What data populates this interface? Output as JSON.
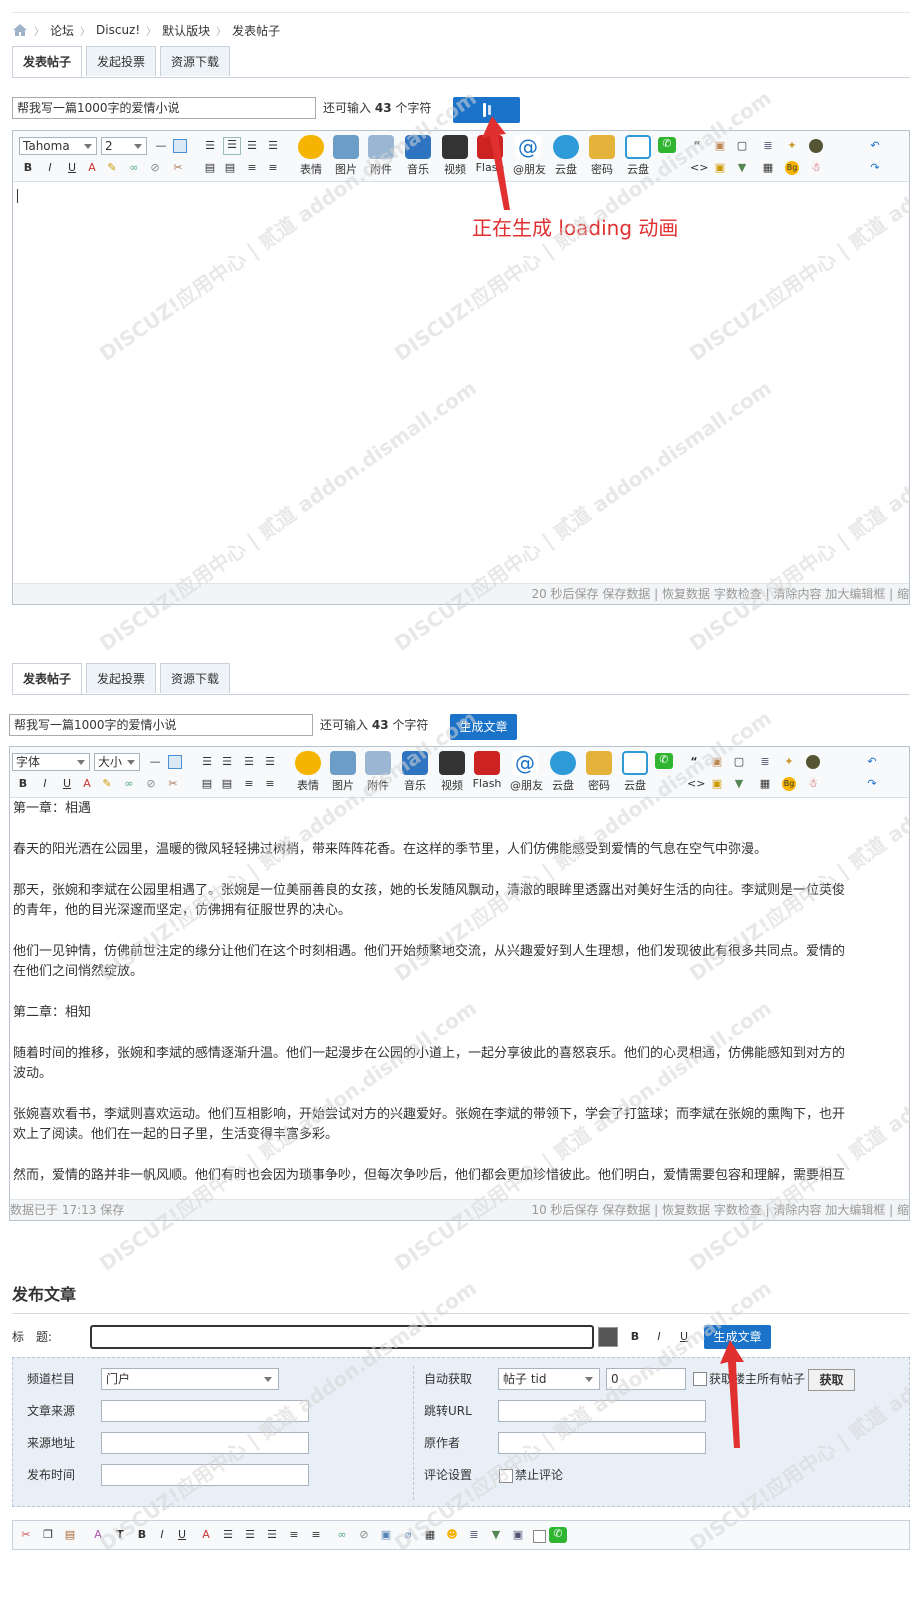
{
  "breadcrumb": {
    "items": [
      "论坛",
      "Discuz!",
      "默认版块",
      "发表帖子"
    ]
  },
  "tabs": [
    "发表帖子",
    "发起投票",
    "资源下载"
  ],
  "panel1": {
    "subject": "帮我写一篇1000字的爱情小说",
    "remain_prefix": "还可输入",
    "remain_count": "43",
    "remain_suffix": "个字符",
    "font": "Tahoma",
    "size": "2",
    "annotation": "正在生成 loading 动画",
    "status_right": "20 秒后保存 保存数据 | 恢复数据    字数检查 | 清除内容    加大编辑框 | 缩"
  },
  "panel2": {
    "subject": "帮我写一篇1000字的爱情小说",
    "remain_prefix": "还可输入",
    "remain_count": "43",
    "remain_suffix": "个字符",
    "generate_label": "生成文章",
    "font": "字体",
    "size": "大小",
    "status_left": "数据已于 17:13 保存",
    "status_right": "10 秒后保存 保存数据 | 恢复数据    字数检查 | 清除内容    加大编辑框 | 缩",
    "paragraphs": [
      [
        "第一章：相遇"
      ],
      [
        "春天的阳光洒在公园里，温暖的微风轻轻拂过树梢，带来阵阵花香。在这样的季节里，人们仿佛能感受到爱情的气息在空气中弥漫。"
      ],
      [
        "那天，张婉和李斌在公园里相遇了。张婉是一位美丽善良的女孩，她的长发随风飘动，清澈的眼眸里透露出对美好生活的向往。李斌则是一位英俊",
        "的青年，他的目光深邃而坚定，仿佛拥有征服世界的决心。"
      ],
      [
        "他们一见钟情，仿佛前世注定的缘分让他们在这个时刻相遇。他们开始频繁地交流，从兴趣爱好到人生理想，他们发现彼此有很多共同点。爱情的",
        "在他们之间悄然绽放。"
      ],
      [
        "第二章：相知"
      ],
      [
        "随着时间的推移，张婉和李斌的感情逐渐升温。他们一起漫步在公园的小道上，一起分享彼此的喜怒哀乐。他们的心灵相通，仿佛能感知到对方的",
        "波动。"
      ],
      [
        "张婉喜欢看书，李斌则喜欢运动。他们互相影响，开始尝试对方的兴趣爱好。张婉在李斌的带领下，学会了打篮球；而李斌在张婉的熏陶下，也开",
        "欢上了阅读。他们在一起的日子里，生活变得丰富多彩。"
      ],
      [
        "然而，爱情的路并非一帆风顺。他们有时也会因为琐事争吵，但每次争吵后，他们都会更加珍惜彼此。他们明白，爱情需要包容和理解，需要相互"
      ]
    ]
  },
  "toolbar": {
    "big_icons": [
      "表情",
      "图片",
      "附件",
      "音乐",
      "视频",
      "Flash",
      "@朋友",
      "云盘",
      "密码",
      "云盘"
    ]
  },
  "publish": {
    "heading": "发布文章",
    "title_label": "标　题:",
    "generate_label": "生成文章",
    "fields": {
      "channel_label": "频道栏目",
      "channel_value": "门户",
      "source_label": "文章来源",
      "source_url_label": "来源地址",
      "publish_time_label": "发布时间",
      "auto_fetch_label": "自动获取",
      "auto_fetch_value": "帖子 tid",
      "tid_value": "0",
      "fetch_all_label": "获取楼主所有帖子",
      "fetch_button": "获取",
      "jump_url_label": "跳转URL",
      "author_label": "原作者",
      "comment_label": "评论设置",
      "disable_comment_label": "禁止评论"
    }
  },
  "watermark": "DISCUZ!应用中心 | 贰道 addon.dismall.com"
}
